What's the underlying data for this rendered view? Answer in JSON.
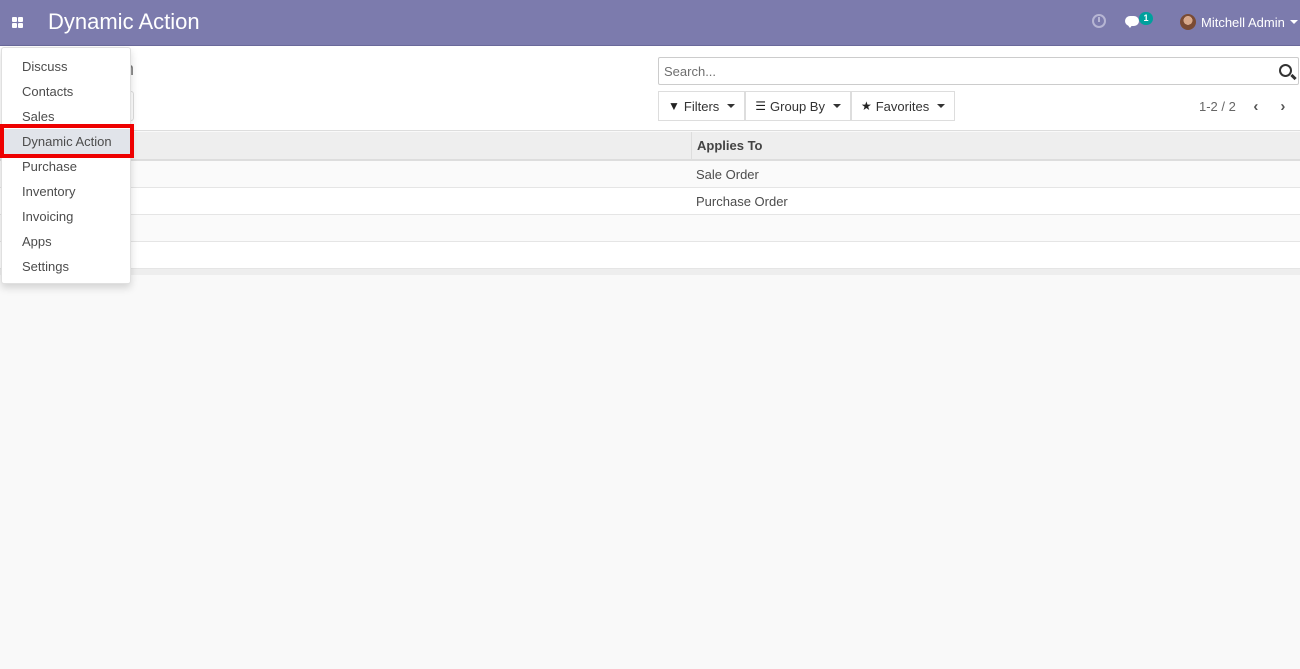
{
  "navbar": {
    "title": "Dynamic Action",
    "apps_icon": "apps-grid-icon",
    "activity_icon": "clock-icon",
    "messages_icon": "chat-icon",
    "messages_count": "1",
    "user_name": "Mitchell Admin",
    "accent_color": "#7c7bad"
  },
  "control_panel": {
    "breadcrumb_partial": "n",
    "search": {
      "placeholder": "Search...",
      "value": ""
    },
    "filters_label": "Filters",
    "group_by_label": "Group By",
    "favorites_label": "Favorites",
    "pager": "1-2 / 2"
  },
  "table": {
    "columns": [
      "",
      "Applies To"
    ],
    "rows": [
      {
        "applies_to": "Sale Order"
      },
      {
        "applies_to": "Purchase Order"
      },
      {
        "applies_to": ""
      },
      {
        "applies_to": ""
      }
    ]
  },
  "apps_menu": {
    "items": [
      {
        "label": "Discuss"
      },
      {
        "label": "Contacts"
      },
      {
        "label": "Sales"
      },
      {
        "label": "Dynamic Action",
        "active": true
      },
      {
        "label": "Purchase"
      },
      {
        "label": "Inventory"
      },
      {
        "label": "Invoicing"
      },
      {
        "label": "Apps"
      },
      {
        "label": "Settings"
      }
    ],
    "highlight_color": "#ee0000"
  }
}
